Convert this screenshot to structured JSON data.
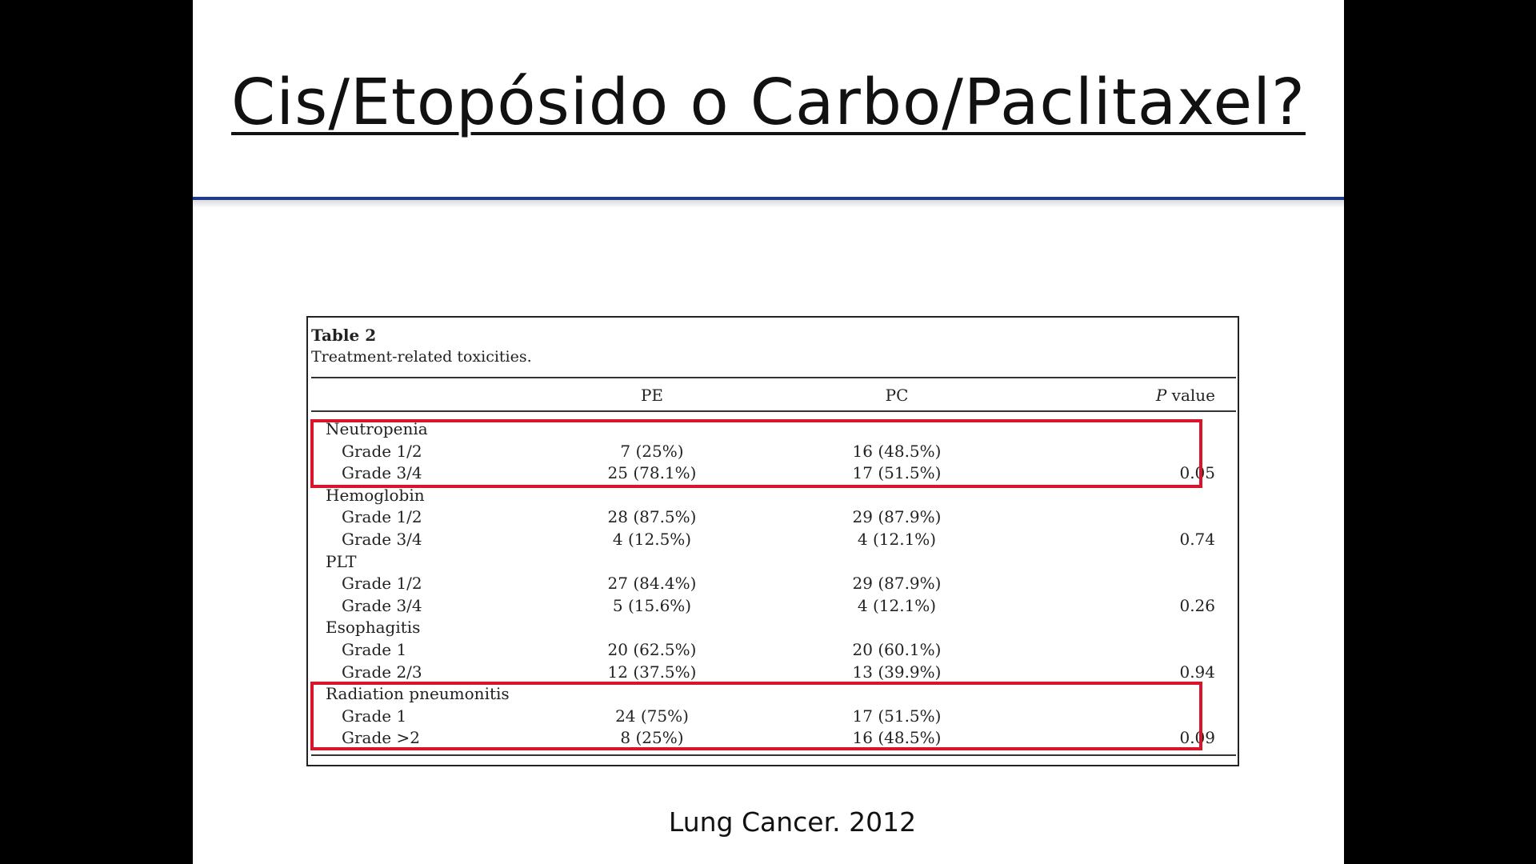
{
  "slide": {
    "title": "Cis/Etopósido o Carbo/Paclitaxel?",
    "footer": "Lung Cancer. 2012"
  },
  "table": {
    "label": "Table 2",
    "caption": "Treatment-related toxicities.",
    "headers": {
      "pe": "PE",
      "pc": "PC",
      "p_italic": "P",
      "p_rest": " value"
    },
    "rows": [
      {
        "label": "Neutropenia",
        "indent": false,
        "pe": "",
        "pc": "",
        "p": ""
      },
      {
        "label": "Grade 1/2",
        "indent": true,
        "pe": "7 (25%)",
        "pc": "16 (48.5%)",
        "p": ""
      },
      {
        "label": "Grade 3/4",
        "indent": true,
        "pe": "25 (78.1%)",
        "pc": "17 (51.5%)",
        "p": "0.05"
      },
      {
        "label": "Hemoglobin",
        "indent": false,
        "pe": "",
        "pc": "",
        "p": ""
      },
      {
        "label": "Grade 1/2",
        "indent": true,
        "pe": "28 (87.5%)",
        "pc": "29 (87.9%)",
        "p": ""
      },
      {
        "label": "Grade 3/4",
        "indent": true,
        "pe": "4 (12.5%)",
        "pc": "4 (12.1%)",
        "p": "0.74"
      },
      {
        "label": "PLT",
        "indent": false,
        "pe": "",
        "pc": "",
        "p": ""
      },
      {
        "label": "Grade 1/2",
        "indent": true,
        "pe": "27 (84.4%)",
        "pc": "29 (87.9%)",
        "p": ""
      },
      {
        "label": "Grade 3/4",
        "indent": true,
        "pe": "5 (15.6%)",
        "pc": "4 (12.1%)",
        "p": "0.26"
      },
      {
        "label": "Esophagitis",
        "indent": false,
        "pe": "",
        "pc": "",
        "p": ""
      },
      {
        "label": "Grade 1",
        "indent": true,
        "pe": "20 (62.5%)",
        "pc": "20 (60.1%)",
        "p": ""
      },
      {
        "label": "Grade 2/3",
        "indent": true,
        "pe": "12 (37.5%)",
        "pc": "13 (39.9%)",
        "p": "0.94"
      },
      {
        "label": "Radiation pneumonitis",
        "indent": false,
        "pe": "",
        "pc": "",
        "p": ""
      },
      {
        "label": "Grade 1",
        "indent": true,
        "pe": "24 (75%)",
        "pc": "17 (51.5%)",
        "p": ""
      },
      {
        "label": "Grade >2",
        "indent": true,
        "pe": "8 (25%)",
        "pc": "16 (48.5%)",
        "p": "0.09"
      }
    ]
  },
  "colors": {
    "highlight": "#d8152a",
    "title_rule": "#1f3c88"
  }
}
